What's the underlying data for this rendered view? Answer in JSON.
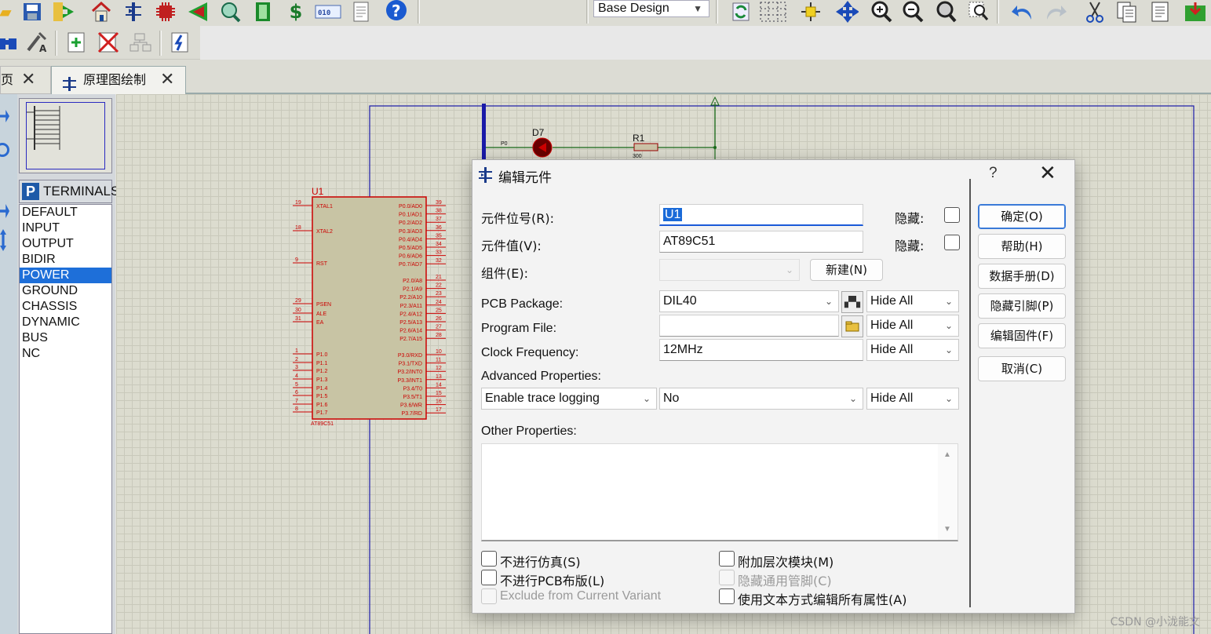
{
  "toolbar": {
    "variant_select": "Base Design",
    "top_icons": [
      "folder-icon",
      "save-icon",
      "import-icon",
      "home-icon",
      "schematic-icon",
      "chip-icon",
      "gerber-icon",
      "3d-view-icon",
      "bom-icon",
      "dollar-icon",
      "binary-icon",
      "document-icon",
      "help-icon"
    ],
    "right_icons": [
      "refresh-icon",
      "grid-icon",
      "origin-icon",
      "pan-icon",
      "zoom-in-icon",
      "zoom-out-icon",
      "zoom-all-icon",
      "zoom-area-icon",
      "undo-icon",
      "redo-icon",
      "cut-icon",
      "copy-icon",
      "paste-icon",
      "block-icon"
    ]
  },
  "tabs": [
    {
      "label": "页"
    },
    {
      "label": "原理图绘制"
    }
  ],
  "left_panel": {
    "badge": "P",
    "header": "TERMINALS",
    "items": [
      "DEFAULT",
      "INPUT",
      "OUTPUT",
      "BIDIR",
      "POWER",
      "GROUND",
      "CHASSIS",
      "DYNAMIC",
      "BUS",
      "NC"
    ],
    "selected": "POWER"
  },
  "schematic": {
    "u1_ref": "U1",
    "u1_name": "AT89C51",
    "d7_ref": "D7",
    "r1_ref": "R1",
    "r1_val": "300",
    "p0_label": "P0",
    "left_pins": [
      [
        "19",
        "XTAL1"
      ],
      [
        "18",
        "XTAL2"
      ],
      [
        "9",
        "RST"
      ],
      [
        "29",
        "PSEN"
      ],
      [
        "30",
        "ALE"
      ],
      [
        "31",
        "EA"
      ],
      [
        "1",
        "P1.0"
      ],
      [
        "2",
        "P1.1"
      ],
      [
        "3",
        "P1.2"
      ],
      [
        "4",
        "P1.3"
      ],
      [
        "5",
        "P1.4"
      ],
      [
        "6",
        "P1.5"
      ],
      [
        "7",
        "P1.6"
      ],
      [
        "8",
        "P1.7"
      ]
    ],
    "right_pins": [
      [
        "39",
        "P0.0/AD0"
      ],
      [
        "38",
        "P0.1/AD1"
      ],
      [
        "37",
        "P0.2/AD2"
      ],
      [
        "36",
        "P0.3/AD3"
      ],
      [
        "35",
        "P0.4/AD4"
      ],
      [
        "34",
        "P0.5/AD5"
      ],
      [
        "33",
        "P0.6/AD6"
      ],
      [
        "32",
        "P0.7/AD7"
      ],
      [
        "21",
        "P2.0/A8"
      ],
      [
        "22",
        "P2.1/A9"
      ],
      [
        "23",
        "P2.2/A10"
      ],
      [
        "24",
        "P2.3/A11"
      ],
      [
        "25",
        "P2.4/A12"
      ],
      [
        "26",
        "P2.5/A13"
      ],
      [
        "27",
        "P2.6/A14"
      ],
      [
        "28",
        "P2.7/A15"
      ],
      [
        "10",
        "P3.0/RXD"
      ],
      [
        "11",
        "P3.1/TXD"
      ],
      [
        "12",
        "P3.2/INT0"
      ],
      [
        "13",
        "P3.3/INT1"
      ],
      [
        "14",
        "P3.4/T0"
      ],
      [
        "15",
        "P3.5/T1"
      ],
      [
        "16",
        "P3.6/WR"
      ],
      [
        "17",
        "P3.7/RD"
      ]
    ]
  },
  "dialog": {
    "title": "编辑元件",
    "help": "?",
    "close": "✕",
    "ref_label": "元件位号(R):",
    "ref_value": "U1",
    "hide_label1": "隐藏:",
    "value_label": "元件值(V):",
    "value_value": "AT89C51",
    "hide_label2": "隐藏:",
    "group_label": "组件(E):",
    "new_button": "新建(N)",
    "pcb_label": "PCB Package:",
    "pcb_value": "DIL40",
    "pcb_hide": "Hide All",
    "prog_label": "Program File:",
    "prog_value": "",
    "prog_hide": "Hide All",
    "clock_label": "Clock Frequency:",
    "clock_value": "12MHz",
    "clock_hide": "Hide All",
    "adv_label": "Advanced Properties:",
    "adv_prop": "Enable trace logging",
    "adv_value": "No",
    "adv_hide": "Hide All",
    "other_label": "Other Properties:",
    "cb_nosim": "不进行仿真(S)",
    "cb_nopcb": "不进行PCB布版(L)",
    "cb_exclude": "Exclude from Current Variant",
    "cb_hier": "附加层次模块(M)",
    "cb_hidepins": "隐藏通用管脚(C)",
    "cb_textedit": "使用文本方式编辑所有属性(A)",
    "btn_ok": "确定(O)",
    "btn_help": "帮助(H)",
    "btn_datasheet": "数据手册(D)",
    "btn_hidepins": "隐藏引脚(P)",
    "btn_firmware": "编辑固件(F)",
    "btn_cancel": "取消(C)"
  },
  "watermark": "CSDN @小泷能文"
}
